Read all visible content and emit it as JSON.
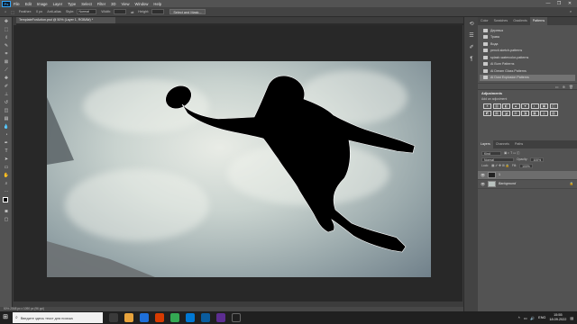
{
  "menubar": {
    "app_logo": "Ps",
    "items": [
      "File",
      "Edit",
      "Image",
      "Layer",
      "Type",
      "Select",
      "Filter",
      "3D",
      "View",
      "Window",
      "Help"
    ],
    "window_controls": [
      "—",
      "❐",
      "✕"
    ]
  },
  "optionsbar": {
    "feather_label": "Feather:",
    "feather_value": "0 px",
    "antialias_label": "Anti-alias",
    "style_label": "Style:",
    "style_value": "Normal",
    "width_label": "Width:",
    "height_label": "Height:",
    "select_mask_button": "Select and Mask..."
  },
  "document": {
    "tab_title": "TemplateForAction.psd @ 50% (Layer 1, RGB/8#) *",
    "status": "50%   2048 px x 1090 px (96 ppi)"
  },
  "patterns_panel": {
    "tabs": [
      "Color",
      "Swatches",
      "Gradients",
      "Patterns"
    ],
    "active_tab": "Patterns",
    "items": [
      "Деревья",
      "Трава",
      "Вода",
      "pencil-sketch-patterns",
      "splash-watercolor-patterns",
      "AI Burn Patterns",
      "AI Dream Glass Patterns",
      "AI Dust Explosion Patterns"
    ],
    "selected_item": "AI Dust Explosion Patterns"
  },
  "adjustments_panel": {
    "title": "Adjustments",
    "subtitle": "Add an adjustment",
    "icons": [
      "☀",
      "▥",
      "◧",
      "▲",
      "▼",
      "◐",
      "▣",
      "◫",
      "◩",
      "▤",
      "◪",
      "⊞",
      "◨",
      "▦",
      "◎",
      "▧"
    ]
  },
  "layers_panel": {
    "tabs": [
      "Layers",
      "Channels",
      "Paths"
    ],
    "active_tab": "Layers",
    "kind_label": "Kind",
    "blend_mode": "Normal",
    "opacity_label": "Opacity:",
    "opacity_value": "100%",
    "lock_label": "Lock:",
    "fill_label": "Fill:",
    "fill_value": "100%",
    "layers": [
      {
        "name": "1",
        "selected": true
      },
      {
        "name": "Background",
        "selected": false
      }
    ]
  },
  "taskbar": {
    "search_placeholder": "Введите здесь текст для поиска",
    "language": "ENG",
    "time": "15:55",
    "date": "18.09.2022"
  },
  "colors": {
    "accent_ps": "#31a8ff",
    "panel_bg": "#535353",
    "canvas_bg": "#282828",
    "selected_row": "#737373"
  }
}
